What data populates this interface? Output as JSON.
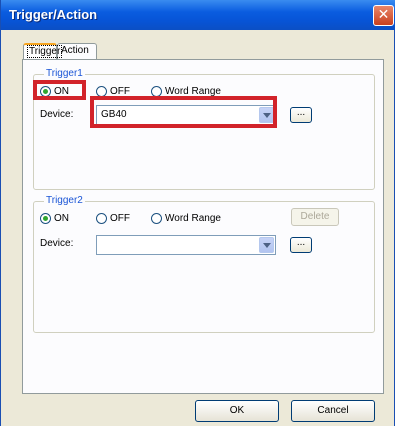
{
  "window": {
    "title": "Trigger/Action",
    "close_glyph": "✕"
  },
  "tabs": [
    {
      "label": "Trigger",
      "active": true
    },
    {
      "label": "Action",
      "active": false
    }
  ],
  "trigger1": {
    "title": "Trigger1",
    "radio_on": "ON",
    "radio_off": "OFF",
    "radio_word_range": "Word Range",
    "selected": "ON",
    "device_label": "Device:",
    "device_value": "GB40",
    "browse_label": "..."
  },
  "trigger2": {
    "title": "Trigger2",
    "radio_on": "ON",
    "radio_off": "OFF",
    "radio_word_range": "Word Range",
    "selected": "ON",
    "delete_label": "Delete",
    "device_label": "Device:",
    "device_value": "",
    "browse_label": "..."
  },
  "footer": {
    "ok_label": "OK",
    "cancel_label": "Cancel"
  },
  "colors": {
    "highlight": "#d2232a",
    "title_bar": "#0754d6",
    "group_title": "#1a55d6"
  }
}
